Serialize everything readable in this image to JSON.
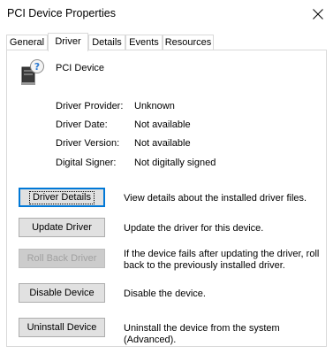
{
  "window": {
    "title": "PCI Device Properties"
  },
  "tabs": [
    {
      "label": "General"
    },
    {
      "label": "Driver"
    },
    {
      "label": "Details"
    },
    {
      "label": "Events"
    },
    {
      "label": "Resources"
    }
  ],
  "active_tab": "Driver",
  "device": {
    "name": "PCI Device",
    "icon": "unknown-device-icon"
  },
  "info": [
    {
      "label": "Driver Provider:",
      "value": "Unknown"
    },
    {
      "label": "Driver Date:",
      "value": "Not available"
    },
    {
      "label": "Driver Version:",
      "value": "Not available"
    },
    {
      "label": "Digital Signer:",
      "value": "Not digitally signed"
    }
  ],
  "actions": [
    {
      "button": "Driver Details",
      "description": "View details about the installed driver files."
    },
    {
      "button": "Update Driver",
      "description": "Update the driver for this device."
    },
    {
      "button": "Roll Back Driver",
      "description": "If the device fails after updating the driver, roll back to the previously installed driver.",
      "disabled": true
    },
    {
      "button": "Disable Device",
      "description": "Disable the device."
    },
    {
      "button": "Uninstall Device",
      "description": "Uninstall the device from the system (Advanced)."
    }
  ],
  "colors": {
    "focus_border": "#0078d7",
    "button_face": "#e1e1e1",
    "disabled_text": "#a0a0a0"
  }
}
